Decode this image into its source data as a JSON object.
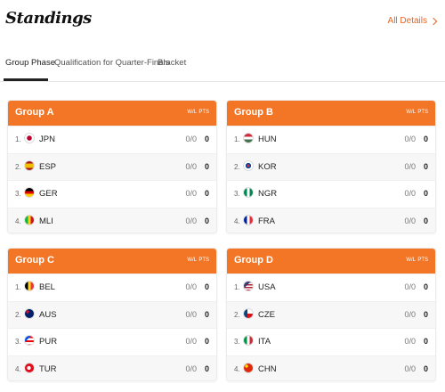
{
  "header": {
    "title": "Standings",
    "all_details": "All Details"
  },
  "tabs": [
    {
      "label": "Group Phase",
      "active": true
    },
    {
      "label": "Qualification for Quarter-Finals",
      "active": false
    },
    {
      "label": "Bracket",
      "active": false
    }
  ],
  "columns": {
    "wl": "W/L",
    "pts": "PTS"
  },
  "groups": [
    {
      "name": "Group A",
      "teams": [
        {
          "rank": "1.",
          "code": "JPN",
          "wl": "0/0",
          "pts": "0",
          "flag": "japan"
        },
        {
          "rank": "2.",
          "code": "ESP",
          "wl": "0/0",
          "pts": "0",
          "flag": "spain"
        },
        {
          "rank": "3.",
          "code": "GER",
          "wl": "0/0",
          "pts": "0",
          "flag": "germany"
        },
        {
          "rank": "4.",
          "code": "MLI",
          "wl": "0/0",
          "pts": "0",
          "flag": "mali"
        }
      ]
    },
    {
      "name": "Group B",
      "teams": [
        {
          "rank": "1.",
          "code": "HUN",
          "wl": "0/0",
          "pts": "0",
          "flag": "hungary"
        },
        {
          "rank": "2.",
          "code": "KOR",
          "wl": "0/0",
          "pts": "0",
          "flag": "korea"
        },
        {
          "rank": "3.",
          "code": "NGR",
          "wl": "0/0",
          "pts": "0",
          "flag": "nigeria"
        },
        {
          "rank": "4.",
          "code": "FRA",
          "wl": "0/0",
          "pts": "0",
          "flag": "france"
        }
      ]
    },
    {
      "name": "Group C",
      "teams": [
        {
          "rank": "1.",
          "code": "BEL",
          "wl": "0/0",
          "pts": "0",
          "flag": "belgium"
        },
        {
          "rank": "2.",
          "code": "AUS",
          "wl": "0/0",
          "pts": "0",
          "flag": "australia"
        },
        {
          "rank": "3.",
          "code": "PUR",
          "wl": "0/0",
          "pts": "0",
          "flag": "puerto-rico"
        },
        {
          "rank": "4.",
          "code": "TUR",
          "wl": "0/0",
          "pts": "0",
          "flag": "turkey"
        }
      ]
    },
    {
      "name": "Group D",
      "teams": [
        {
          "rank": "1.",
          "code": "USA",
          "wl": "0/0",
          "pts": "0",
          "flag": "usa"
        },
        {
          "rank": "2.",
          "code": "CZE",
          "wl": "0/0",
          "pts": "0",
          "flag": "czechia"
        },
        {
          "rank": "3.",
          "code": "ITA",
          "wl": "0/0",
          "pts": "0",
          "flag": "italy"
        },
        {
          "rank": "4.",
          "code": "CHN",
          "wl": "0/0",
          "pts": "0",
          "flag": "china"
        }
      ]
    }
  ],
  "colors": {
    "accent": "#f27625",
    "link": "#e8641e"
  }
}
